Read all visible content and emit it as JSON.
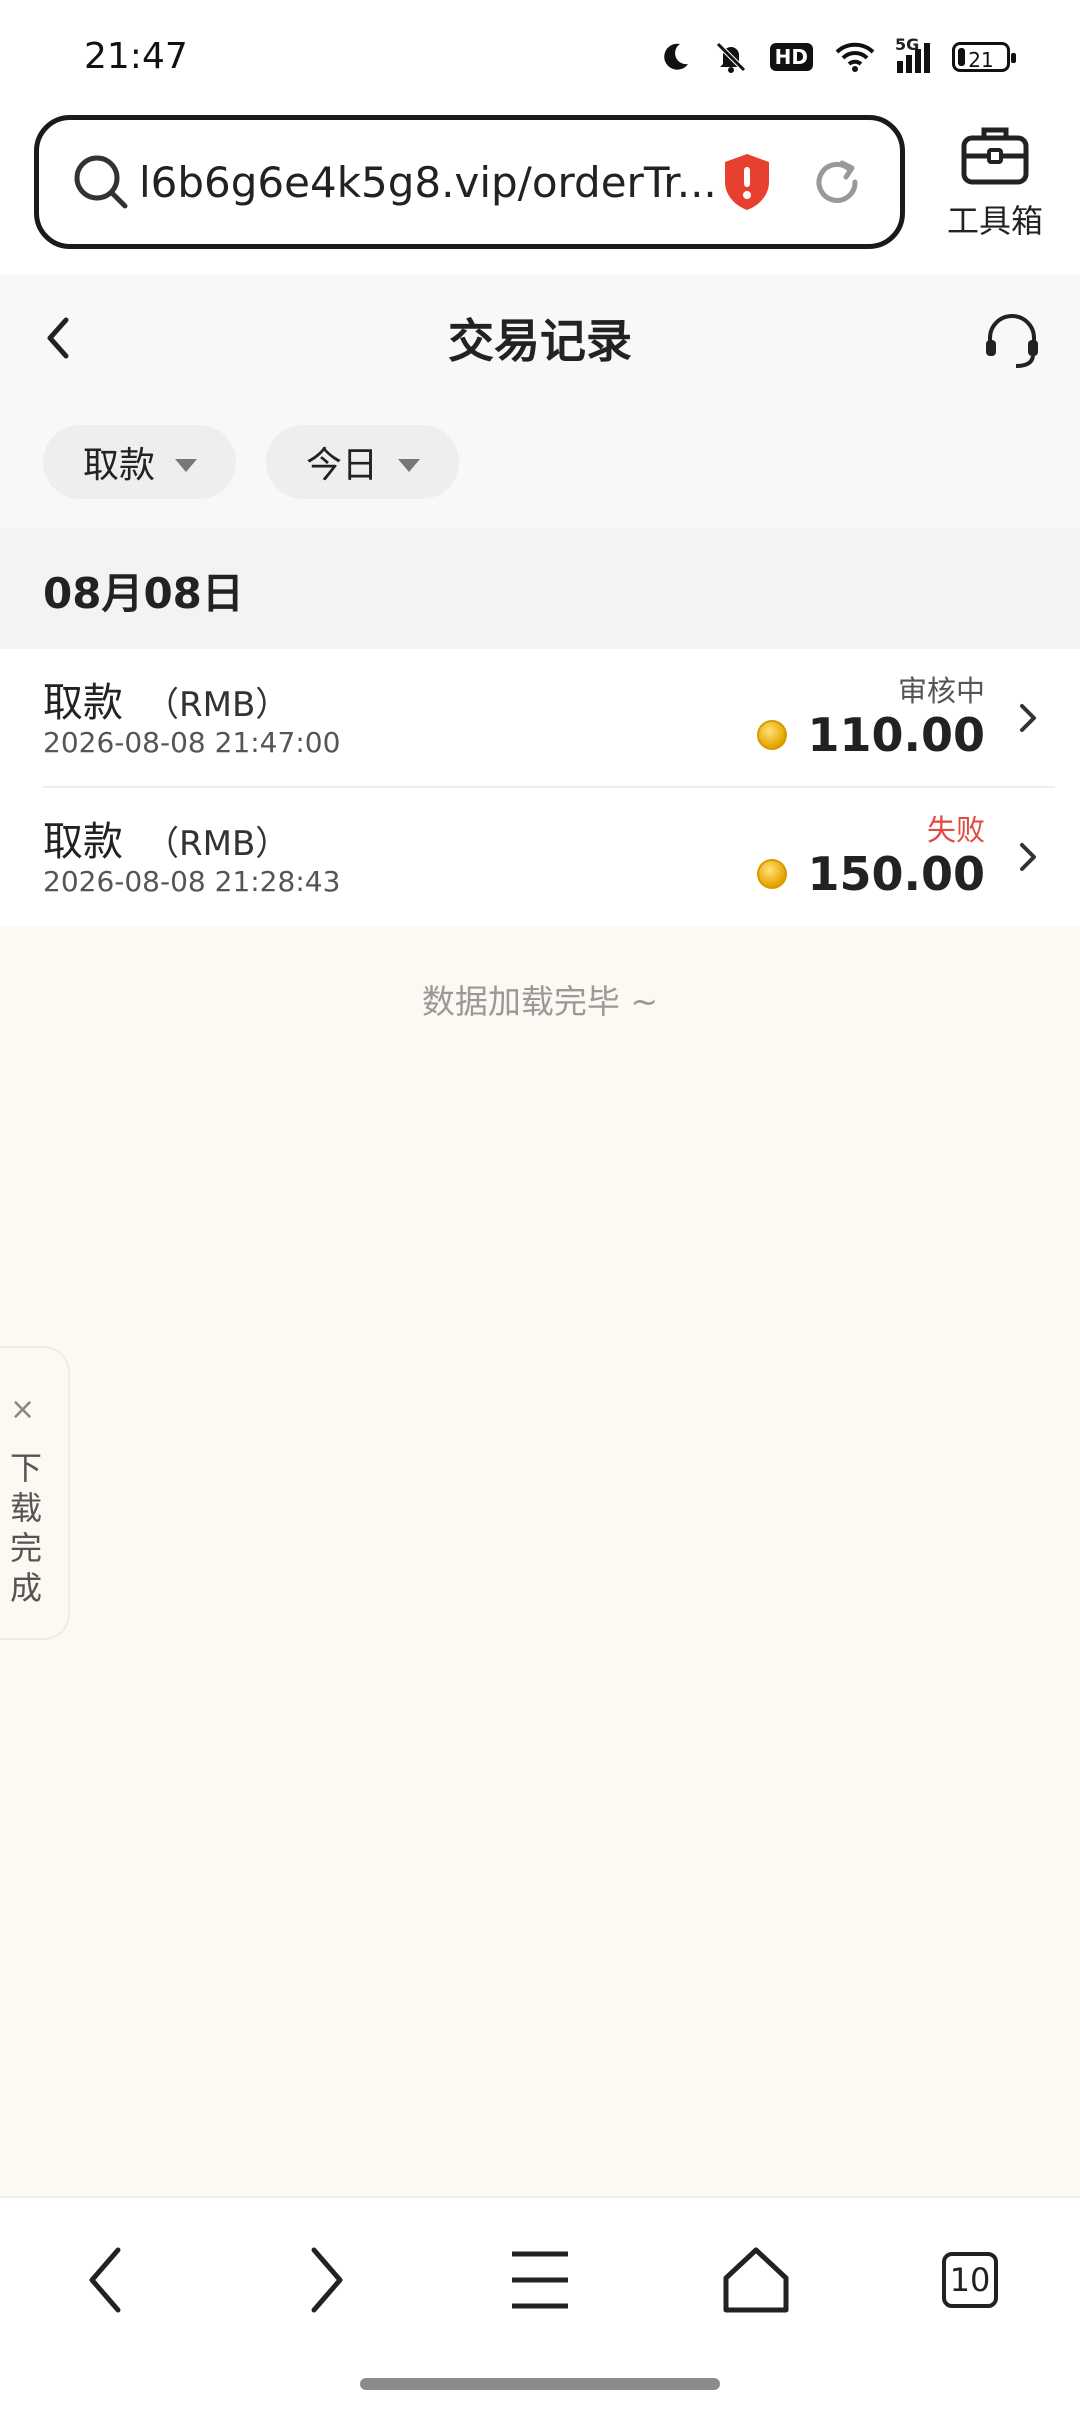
{
  "status_bar": {
    "time": "21:47",
    "hd": "HD",
    "network": "5G",
    "battery": "21"
  },
  "browser": {
    "url": "l6b6g6e4k5g8.vip/orderTr...",
    "toolbox_label": "工具箱",
    "tab_count": "10"
  },
  "header": {
    "title": "交易记录"
  },
  "filters": {
    "type": "取款",
    "period": "今日"
  },
  "date_group": "08月08日",
  "records": [
    {
      "type": "取款",
      "currency": "（RMB）",
      "time": "2026-08-08 21:47:00",
      "status": "审核中",
      "status_color": "#555555",
      "amount": "110.00"
    },
    {
      "type": "取款",
      "currency": "（RMB）",
      "time": "2026-08-08 21:28:43",
      "status": "失败",
      "status_color": "#e04a3f",
      "amount": "150.00"
    }
  ],
  "load_complete_text": "数据加载完毕 ~",
  "download_tab": {
    "label": "下载完成",
    "close": "×"
  },
  "colors": {
    "shield": "#e8402e",
    "accent_bg": "#fdf8f1"
  }
}
